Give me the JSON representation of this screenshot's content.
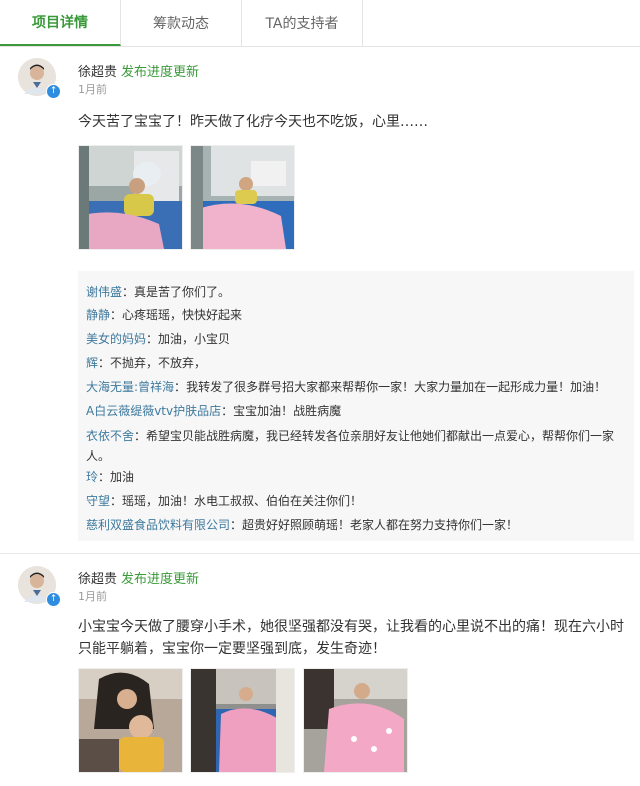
{
  "tabs": [
    {
      "label": "项目详情",
      "active": true
    },
    {
      "label": "筹款动态",
      "active": false
    },
    {
      "label": "TA的支持者",
      "active": false
    }
  ],
  "posts": [
    {
      "author": "徐超贵",
      "action": "发布进度更新",
      "time": "1月前",
      "content": "今天苦了宝宝了！昨天做了化疗今天也不吃饭，心里……",
      "comments": [
        {
          "name": "谢伟盛",
          "text": "真是苦了你们了。"
        },
        {
          "name": "静静",
          "text": "心疼瑶瑶，快快好起来"
        },
        {
          "name": "美女的妈妈",
          "text": "加油，小宝贝"
        },
        {
          "name": "辉",
          "text": "不抛弃，不放弃，"
        },
        {
          "name": "大海无量:曾祥海",
          "text": "我转发了很多群号招大家都来帮帮你一家！大家力量加在一起形成力量！加油！"
        },
        {
          "name": "A白云薇缇薇vtv护肤品店",
          "text": "宝宝加油！战胜病魔"
        },
        {
          "name": "衣依不舍",
          "text": "希望宝贝能战胜病魔，我已经转发各位亲朋好友让他她们都献出一点爱心，帮帮你们一家人。"
        },
        {
          "name": "玲",
          "text": "加油"
        },
        {
          "name": "守望",
          "text": "瑶瑶，加油！水电工叔叔、伯伯在关注你们！"
        },
        {
          "name": "慈利双盛食品饮料有限公司",
          "text": "超贵好好照顾萌瑶！老家人都在努力支持你们一家！"
        }
      ]
    },
    {
      "author": "徐超贵",
      "action": "发布进度更新",
      "time": "1月前",
      "content": "小宝宝今天做了腰穿小手术，她很坚强都没有哭，让我看的心里说不出的痛！现在六小时只能平躺着，宝宝你一定要坚强到底，发生奇迹！"
    }
  ],
  "colors": {
    "accent": "#3a9a3a",
    "comment_name": "#3e7a9e",
    "badge": "#2f8de0"
  },
  "icons": {
    "avatar_badge": "arrow-up-icon"
  }
}
